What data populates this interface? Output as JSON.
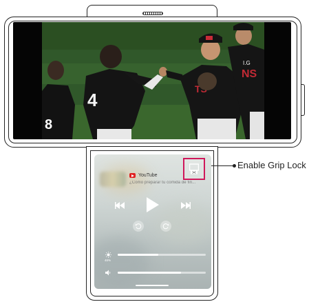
{
  "callout": {
    "label": "Enable Grip Lock"
  },
  "media": {
    "app_icon": "youtube-logo-icon",
    "app_name": "YouTube",
    "subtitle": "¿Cómo preparar tu comida de fin..."
  },
  "controls": {
    "previous_icon": "skip-previous-icon",
    "play_icon": "play-icon",
    "next_icon": "skip-next-icon",
    "rewind_icon": "rewind-icon",
    "forward_icon": "forward-icon"
  },
  "brightness": {
    "icon": "brightness-icon",
    "label": "46%",
    "level": 0.46
  },
  "volume": {
    "icon": "volume-icon",
    "level": 0.72
  },
  "grip_lock": {
    "icon": "grip-lock-icon"
  },
  "colors": {
    "highlight": "#d0165a",
    "youtube_red": "#e02020"
  }
}
